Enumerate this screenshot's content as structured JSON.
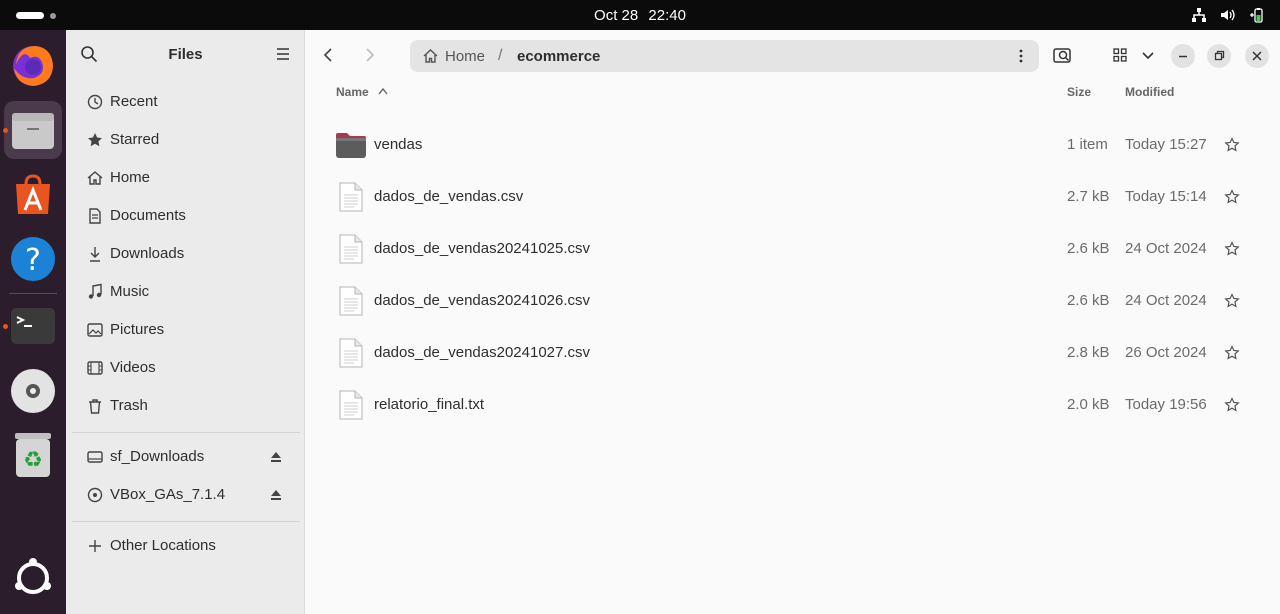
{
  "topbar": {
    "date": "Oct 28",
    "time": "22:40"
  },
  "dock": {
    "items": [
      {
        "name": "firefox-icon"
      },
      {
        "name": "files-icon"
      },
      {
        "name": "app-center-icon"
      },
      {
        "name": "help-icon"
      },
      {
        "name": "terminal-icon"
      },
      {
        "name": "disc-icon"
      },
      {
        "name": "trash-icon"
      },
      {
        "name": "show-apps-icon"
      }
    ]
  },
  "sidebar": {
    "title": "Files",
    "places": [
      {
        "label": "Recent",
        "icon": "clock-icon"
      },
      {
        "label": "Starred",
        "icon": "star-icon"
      },
      {
        "label": "Home",
        "icon": "home-icon"
      },
      {
        "label": "Documents",
        "icon": "document-icon"
      },
      {
        "label": "Downloads",
        "icon": "download-icon"
      },
      {
        "label": "Music",
        "icon": "music-icon"
      },
      {
        "label": "Pictures",
        "icon": "picture-icon"
      },
      {
        "label": "Videos",
        "icon": "video-icon"
      },
      {
        "label": "Trash",
        "icon": "trash-icon"
      }
    ],
    "devices": [
      {
        "label": "sf_Downloads",
        "icon": "drive-icon"
      },
      {
        "label": "VBox_GAs_7.1.4",
        "icon": "disc-icon"
      }
    ],
    "other": {
      "label": "Other Locations",
      "icon": "plus-icon"
    }
  },
  "path": {
    "home": "Home",
    "separator": "/",
    "current": "ecommerce"
  },
  "columns": {
    "name": "Name",
    "size": "Size",
    "modified": "Modified"
  },
  "files": [
    {
      "name": "vendas",
      "size": "1 item",
      "modified": "Today 15:27",
      "type": "folder"
    },
    {
      "name": "dados_de_vendas.csv",
      "size": "2.7 kB",
      "modified": "Today 15:14",
      "type": "file"
    },
    {
      "name": "dados_de_vendas20241025.csv",
      "size": "2.6 kB",
      "modified": "24 Oct 2024",
      "type": "file"
    },
    {
      "name": "dados_de_vendas20241026.csv",
      "size": "2.6 kB",
      "modified": "24 Oct 2024",
      "type": "file"
    },
    {
      "name": "dados_de_vendas20241027.csv",
      "size": "2.8 kB",
      "modified": "26 Oct 2024",
      "type": "file"
    },
    {
      "name": "relatorio_final.txt",
      "size": "2.0 kB",
      "modified": "Today 19:56",
      "type": "file"
    }
  ],
  "colors": {
    "accent": "#e95420",
    "dock_bg": "#2b1d2c",
    "sidebar_bg": "#ebebeb"
  }
}
